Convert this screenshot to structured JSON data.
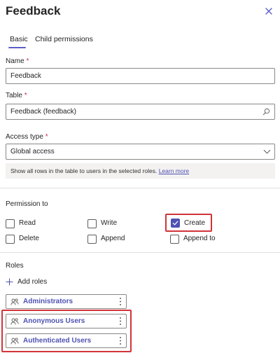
{
  "panel": {
    "title": "Feedback",
    "tabs": [
      {
        "label": "Basic"
      },
      {
        "label": "Child permissions"
      }
    ]
  },
  "form": {
    "name": {
      "label": "Name",
      "required_mark": "*",
      "value": "Feedback"
    },
    "table": {
      "label": "Table",
      "required_mark": "*",
      "value": "Feedback (feedback)"
    },
    "access_type": {
      "label": "Access type",
      "required_mark": "*",
      "value": "Global access",
      "hint": "Show all rows in the table to users in the selected roles.",
      "hint_link": "Learn more"
    }
  },
  "permissions": {
    "heading": "Permission to",
    "items": [
      {
        "label": "Read",
        "checked": false
      },
      {
        "label": "Write",
        "checked": false
      },
      {
        "label": "Create",
        "checked": true
      },
      {
        "label": "Delete",
        "checked": false
      },
      {
        "label": "Append",
        "checked": false
      },
      {
        "label": "Append to",
        "checked": false
      }
    ]
  },
  "roles": {
    "heading": "Roles",
    "add_label": "Add roles",
    "items": [
      {
        "name": "Administrators"
      },
      {
        "name": "Anonymous Users"
      },
      {
        "name": "Authenticated Users"
      }
    ]
  },
  "icons": {
    "close": "close-icon",
    "search": "search-icon",
    "dropdown": "chevron-down-icon",
    "add": "plus-icon",
    "role": "people-icon",
    "more": "more-vertical-icon"
  },
  "colors": {
    "accent": "#5b5fc7",
    "link": "#4f52b2",
    "highlight": "#d13438",
    "required": "#c4314b"
  }
}
